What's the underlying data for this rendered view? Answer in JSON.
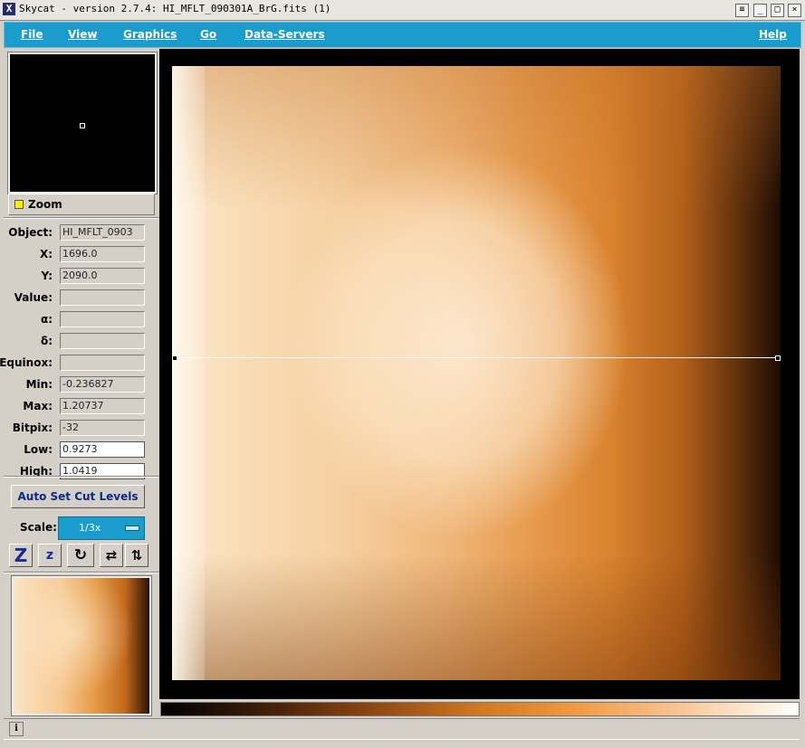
{
  "window": {
    "title": "Skycat - version 2.7.4: HI_MFLT_090301A_BrG.fits (1)",
    "app_icon": "X",
    "controls": [
      "≡",
      "_",
      "□",
      "×"
    ]
  },
  "menubar": {
    "items": [
      "File",
      "View",
      "Graphics",
      "Go",
      "Data-Servers"
    ],
    "help": "Help"
  },
  "zoom": {
    "label": "Zoom",
    "checked": true
  },
  "info": {
    "rows": [
      {
        "label": "Object:",
        "value": "HI_MFLT_0903"
      },
      {
        "label": "X:",
        "value": "1696.0"
      },
      {
        "label": "Y:",
        "value": "2090.0"
      },
      {
        "label": "Value:",
        "value": ""
      },
      {
        "label": "α:",
        "value": ""
      },
      {
        "label": "δ:",
        "value": ""
      },
      {
        "label": "Equinox:",
        "value": ""
      },
      {
        "label": "Min:",
        "value": "-0.236827"
      },
      {
        "label": "Max:",
        "value": "1.20737"
      },
      {
        "label": "Bitpix:",
        "value": "-32"
      },
      {
        "label": "Low:",
        "value": "0.9273"
      },
      {
        "label": "High:",
        "value": "1.0419"
      }
    ]
  },
  "cut_levels": {
    "button_label": "Auto Set Cut Levels"
  },
  "scale": {
    "label": "Scale:",
    "value": "1/3x"
  },
  "toolbar": {
    "zoom_in": "Z",
    "zoom_out": "z",
    "rotate": "↻",
    "flip_x": "⇄",
    "flip_y": "⇅"
  },
  "status": {
    "icon": "i",
    "text": ""
  },
  "colors": {
    "menubar": "#1a9ccd",
    "colormap": "heat",
    "background": "#d4d0c8"
  }
}
